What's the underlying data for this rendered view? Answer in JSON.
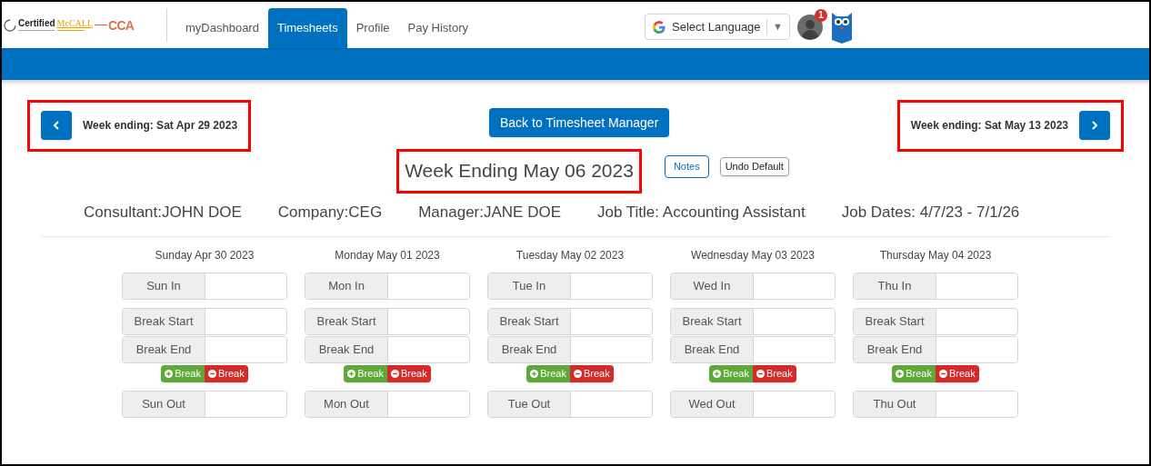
{
  "logo": {
    "texts": [
      "Certified",
      "McCALL",
      "CCA"
    ]
  },
  "nav": [
    {
      "label": "myDashboard",
      "selected": false
    },
    {
      "label": "Timesheets",
      "selected": true
    },
    {
      "label": "Profile",
      "selected": false
    },
    {
      "label": "Pay History",
      "selected": false
    }
  ],
  "language_select": {
    "label": "Select Language",
    "arrow": "▼"
  },
  "notification_count": "1",
  "prev_week": {
    "label": "Week ending: Sat Apr 29 2023",
    "highlighted": true
  },
  "back_button": "Back to Timesheet Manager",
  "next_week": {
    "label": "Week ending: Sat May 13 2023",
    "highlighted": true
  },
  "title": {
    "text": "Week Ending May 06 2023",
    "highlighted": true
  },
  "notes_button": "Notes",
  "undo_button": "Undo Default",
  "info": [
    "Consultant:JOHN DOE",
    "Company:CEG",
    "Manager:JANE DOE",
    "Job Title: Accounting Assistant",
    "Job Dates: 4/7/23 - 7/1/26"
  ],
  "days": [
    {
      "heading": "Sunday Apr 30 2023",
      "in_label": "Sun In",
      "break_start_label": "Break Start",
      "break_end_label": "Break End",
      "add_break": "Break",
      "remove_break": "Break",
      "out_label": "Sun Out"
    },
    {
      "heading": "Monday May 01 2023",
      "in_label": "Mon In",
      "break_start_label": "Break Start",
      "break_end_label": "Break End",
      "add_break": "Break",
      "remove_break": "Break",
      "out_label": "Mon Out"
    },
    {
      "heading": "Tuesday May 02 2023",
      "in_label": "Tue In",
      "break_start_label": "Break Start",
      "break_end_label": "Break End",
      "add_break": "Break",
      "remove_break": "Break",
      "out_label": "Tue Out"
    },
    {
      "heading": "Wednesday May 03 2023",
      "in_label": "Wed In",
      "break_start_label": "Break Start",
      "break_end_label": "Break End",
      "add_break": "Break",
      "remove_break": "Break",
      "out_label": "Wed Out"
    },
    {
      "heading": "Thursday May 04 2023",
      "in_label": "Thu In",
      "break_start_label": "Break Start",
      "break_end_label": "Break End",
      "add_break": "Break",
      "remove_break": "Break",
      "out_label": "Thu Out"
    }
  ]
}
